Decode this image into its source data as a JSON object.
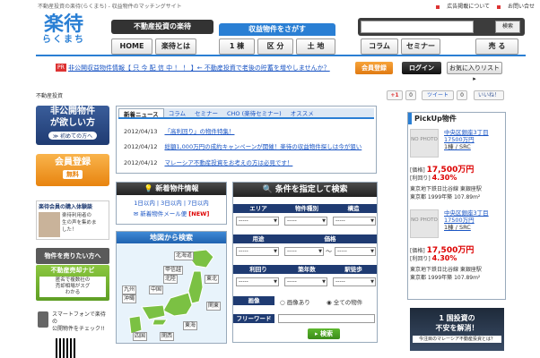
{
  "header": {
    "tagline": "不動産投資の楽待(らくまち) - 収益物件のマッチングサイト",
    "toplinks": [
      "広告掲載について",
      "お問い合せ"
    ],
    "logo_main": "楽待",
    "logo_sub": "らくまち",
    "realestate_label": "不動産投資の楽待",
    "nav": {
      "home": "HOME",
      "about": "楽待とは"
    },
    "search_props_label": "収益物件をさがす",
    "search_tabs": [
      "1 棟",
      "区 分",
      "土 地"
    ],
    "search_placeholder": "",
    "search_button": "検索",
    "right_nav": [
      "コラム",
      "セミナー",
      "売 る"
    ]
  },
  "prbar": {
    "tag": "PR",
    "text": "非公開収益物件情報【 只 今 配 信 中 ！ ！ 】← 不動産投資で老後の貯蓄を増やしませんか？",
    "register": "会員登録",
    "login": "ログイン",
    "favorites": "お気に入りリスト ▸"
  },
  "breadcrumb": "不動産投資",
  "social": {
    "gplus": "+1",
    "gplus_count": "0",
    "tweet": "ツイート",
    "tweet_count": "0",
    "like": "いいね！"
  },
  "left": {
    "hidden_props_title": "非公開物件",
    "hidden_props_sub": "が欲しい方",
    "beginners": "≫ 初めての方へ",
    "register_title": "会員登録",
    "register_sub": "無料",
    "voice_title": "楽待会員の購入体験談",
    "voice_text": [
      "楽待利用者の",
      "生の声を集めま",
      "した！"
    ],
    "sell_label": "物件を売りたい方へ",
    "sell_navi": "不動産売却ナビ",
    "sell_desc": [
      "匿名で複数社の",
      "売却相場がスグ",
      "わかる"
    ],
    "phone_text": [
      "スマートフォンで楽待の",
      "公開物件をチェック!!"
    ]
  },
  "news": {
    "tabs": [
      "新着ニュース",
      "コラム",
      "セミナー",
      "CHO (楽待セミナー)",
      "オススメ"
    ],
    "items": [
      {
        "date": "2012/04/13",
        "text": "「高利回り」の物件特集！"
      },
      {
        "date": "2012/04/12",
        "text": "総額1,000万円の成約キャンペーンが開催！楽待の収益物件探しは今が狙い"
      },
      {
        "date": "2012/04/12",
        "text": "マレーシア不動産投資をお考えの方は必見です！"
      }
    ]
  },
  "new_props": {
    "title": "新着物件情報",
    "links": "1日以内 | 3日以内 | 7日以内",
    "mail": "新着物件メール便",
    "mail_new": "NEW"
  },
  "map": {
    "title": "地図から検索",
    "regions": [
      "北海道",
      "甲信越",
      "北陸",
      "中国",
      "九州",
      "沖縄",
      "東北",
      "関東",
      "東海",
      "関西",
      "四国"
    ]
  },
  "condition": {
    "title": "条件を指定して検索",
    "row1": [
      "エリア",
      "物件種別",
      "構造"
    ],
    "row2": [
      "用途",
      "価格"
    ],
    "row3": [
      "利回り",
      "築年数",
      "駅徒歩"
    ],
    "select_default": "-----",
    "tilde": "〜",
    "image_label": "画像",
    "image_opt1": "画像あり",
    "image_opt2": "全ての物件",
    "free_label": "フリーワード",
    "button": "検索"
  },
  "pickup": {
    "title": "PickUp物件",
    "items": [
      {
        "photo": "NO PHOTO",
        "name": "中央区銀座3丁目",
        "sub": "17500万円",
        "type": "1棟 / SRC",
        "price_label": "[価格]",
        "price": "17,500万円",
        "rate_label": "[利回り]",
        "rate": "4.30%",
        "station": "東京地下鉄日比谷線 東銀座駅",
        "loc": "東京都 1999年築 107.89m²"
      },
      {
        "photo": "NO PHOTO",
        "name": "中央区銀座3丁目",
        "sub": "17500万円",
        "type": "1棟 / SRC",
        "price_label": "[価格]",
        "price": "17,500万円",
        "rate_label": "[利回り]",
        "rate": "4.30%",
        "station": "東京地下鉄日比谷線 東銀座駅",
        "loc": "東京都 1999年築 107.89m²"
      }
    ]
  },
  "ad": {
    "title1": "1 国投資の",
    "title2": "不安を解消！",
    "sub": "今注目のマレーシア不動産投資とは？"
  },
  "colors": {
    "accent": "#2a7fd4",
    "orange": "#e8840f",
    "navy": "#1f3b72",
    "price": "#d00000"
  }
}
